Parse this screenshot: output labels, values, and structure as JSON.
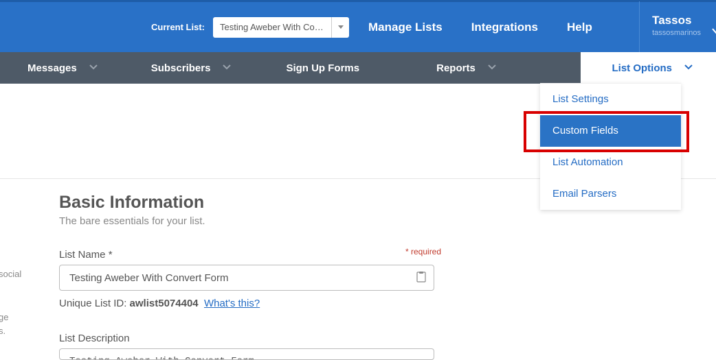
{
  "topbar": {
    "current_list_label": "Current List:",
    "selected_list": "Testing Aweber With Co…",
    "links": {
      "manage_lists": "Manage Lists",
      "integrations": "Integrations",
      "help": "Help"
    },
    "account": {
      "name": "Tassos",
      "sub": "tassosmarinos"
    }
  },
  "nav": {
    "messages": "Messages",
    "subscribers": "Subscribers",
    "signup": "Sign Up Forms",
    "reports": "Reports",
    "list_options": "List Options"
  },
  "dropdown": {
    "items": [
      {
        "label": "List Settings",
        "active": false
      },
      {
        "label": "Custom Fields",
        "active": true
      },
      {
        "label": "List Automation",
        "active": false
      },
      {
        "label": "Email Parsers",
        "active": false
      }
    ]
  },
  "content": {
    "section_title": "Basic Information",
    "section_subtitle": "The bare essentials for your list.",
    "list_name_label": "List Name *",
    "required_note": "* required",
    "list_name_value": "Testing Aweber With Convert Form",
    "unique_id_label": "Unique List ID: ",
    "unique_id_value": "awlist5074404",
    "whats_this": "What's this?",
    "list_description_label": "List Description",
    "list_description_value": "Testing Aweber With Convert Form"
  },
  "cutoff": {
    "a": "social",
    "b1": "ge",
    "b2": "s."
  }
}
